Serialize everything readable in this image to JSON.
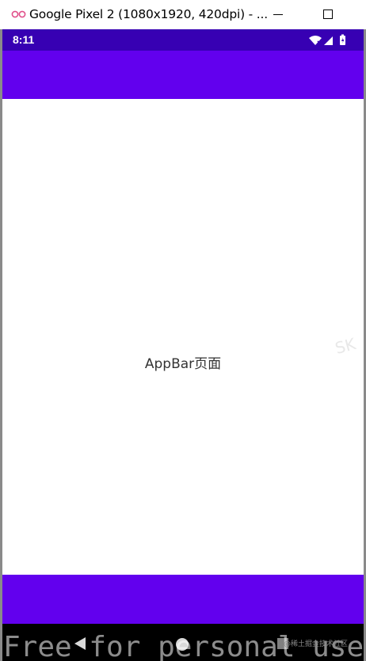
{
  "window": {
    "title": "Google Pixel 2 (1080x1920, 420dpi) - ...",
    "icon": "emulator-icon",
    "controls": [
      "minimize-icon",
      "maximize-icon"
    ]
  },
  "device": {
    "status_bar": {
      "time": "8:11",
      "icons": [
        "wifi-icon",
        "signal-icon",
        "battery-icon"
      ],
      "color": "#3700b3"
    },
    "app_bar": {
      "color": "#6200ee"
    },
    "content": {
      "text": "AppBar页面"
    },
    "bottom_bar": {
      "color": "#6200ee"
    },
    "nav_bar": {
      "icons": [
        "back-icon",
        "home-icon",
        "recents-icon"
      ]
    }
  },
  "overlays": {
    "font_watermark": "Free for personal use",
    "credit": "@稀土掘金技术社区",
    "side_watermark": "SK"
  }
}
